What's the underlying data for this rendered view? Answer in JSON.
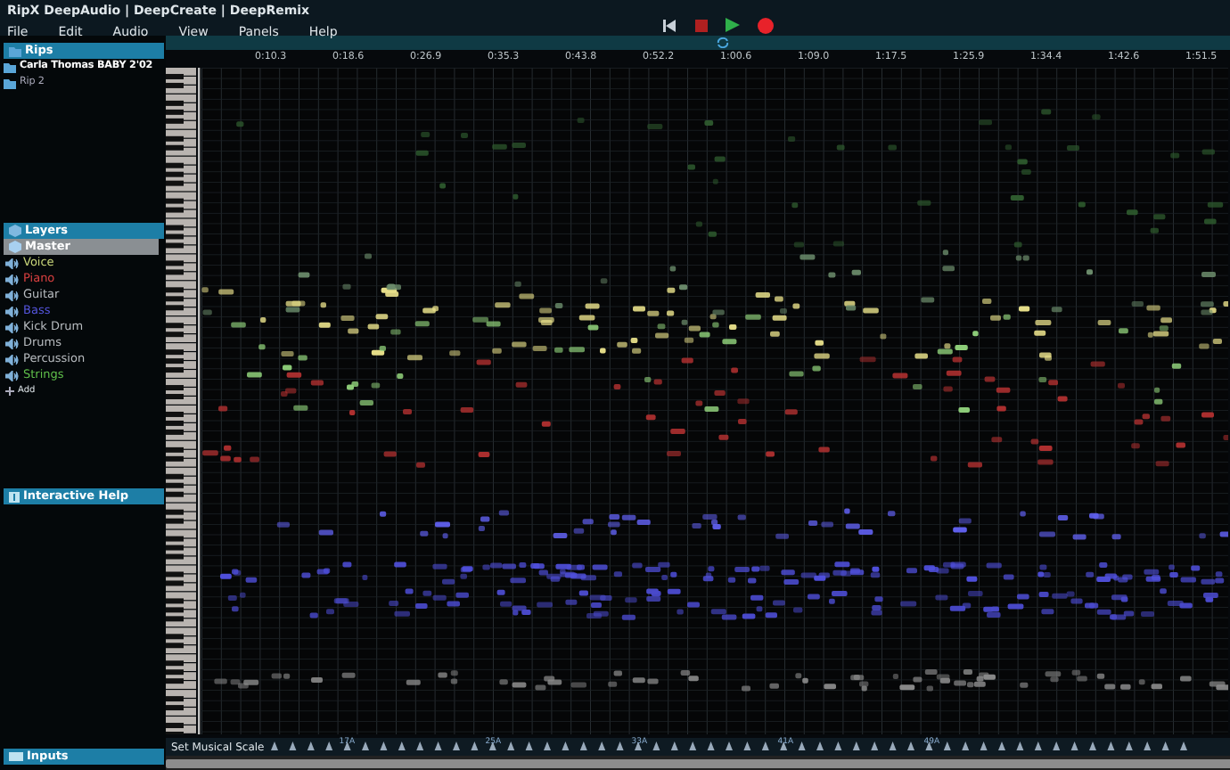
{
  "window": {
    "title": "RipX DeepAudio | DeepCreate | DeepRemix"
  },
  "menu": [
    "File",
    "Edit",
    "Audio",
    "View",
    "Panels",
    "Help"
  ],
  "transport": [
    {
      "kind": "rewind"
    },
    {
      "kind": "stop"
    },
    {
      "kind": "play"
    },
    {
      "kind": "record"
    }
  ],
  "rips": {
    "title": "Rips",
    "items": [
      {
        "label": "Carla Thomas BABY 2'02",
        "selected": true
      },
      {
        "label": "Rip 2",
        "selected": false
      }
    ]
  },
  "layers": {
    "title": "Layers",
    "items": [
      {
        "label": "Master",
        "selected": true,
        "color": "#ffffff"
      },
      {
        "label": "Voice",
        "selected": false,
        "color": "#c8d67a"
      },
      {
        "label": "Piano",
        "selected": false,
        "color": "#d94040"
      },
      {
        "label": "Guitar",
        "selected": false,
        "color": "#b8bcc0"
      },
      {
        "label": "Bass",
        "selected": false,
        "color": "#5555dd"
      },
      {
        "label": "Kick Drum",
        "selected": false,
        "color": "#b8bcc0"
      },
      {
        "label": "Drums",
        "selected": false,
        "color": "#b8bcc0"
      },
      {
        "label": "Percussion",
        "selected": false,
        "color": "#b8bcc0"
      },
      {
        "label": "Strings",
        "selected": false,
        "color": "#5fbf4a"
      }
    ],
    "add": "Add"
  },
  "help": {
    "title": "Interactive Help"
  },
  "inputs": {
    "title": "Inputs"
  },
  "timeline": {
    "labels": [
      "0:10.3",
      "0:18.6",
      "0:26.9",
      "0:35.3",
      "0:43.8",
      "0:52.2",
      "1:00.6",
      "1:09.0",
      "1:17.5",
      "1:25.9",
      "1:34.4",
      "1:42.6",
      "1:51.5"
    ]
  },
  "scale_bar": {
    "label": "Set Musical Scale",
    "markers": [
      "17A",
      "25A",
      "33A",
      "41A",
      "49A"
    ]
  }
}
